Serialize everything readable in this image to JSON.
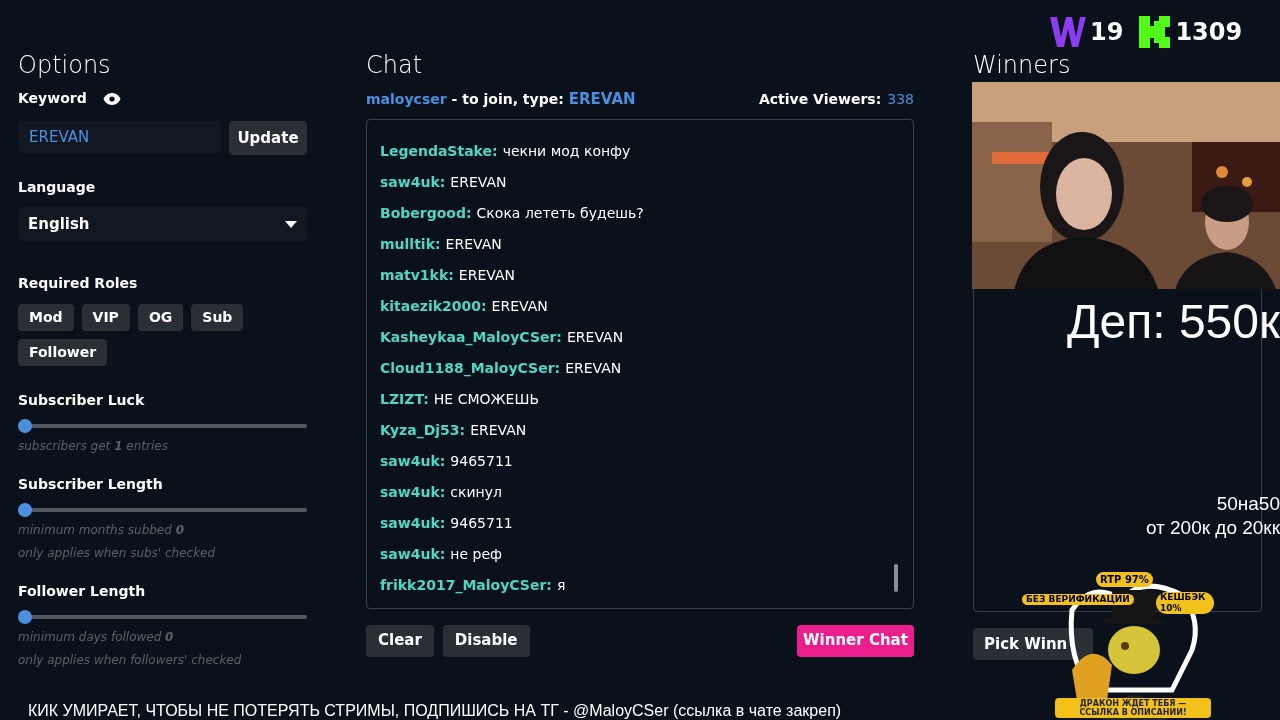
{
  "options": {
    "title": "Options",
    "keyword_label": "Keyword",
    "keyword": {
      "value": "EREVAN"
    },
    "update_button": "Update",
    "language_label": "Language",
    "language": "English",
    "roles_label": "Required Roles",
    "roles": [
      {
        "label": "Mod",
        "selected": false
      },
      {
        "label": "VIP",
        "selected": false
      },
      {
        "label": "OG",
        "selected": false
      },
      {
        "label": "Sub",
        "selected": false
      },
      {
        "label": "Follower",
        "selected": false
      }
    ],
    "sliders": [
      {
        "label": "Subscriber Luck",
        "level": 0,
        "notes": [
          "subscribers get **1** entries"
        ]
      },
      {
        "label": "Subscriber Length",
        "level": 0,
        "notes": [
          "minimum months subbed **0**",
          "only applies when subs' checked"
        ]
      },
      {
        "label": "Follower Length",
        "level": 0,
        "notes": [
          "minimum days followed **0**",
          "only applies when followers' checked"
        ]
      }
    ]
  },
  "chat": {
    "title": "Chat",
    "channel": "maloycser",
    "join_text": "- to join, type:",
    "keyword": "EREVAN",
    "viewers_label": "Active Viewers:",
    "viewers": "338",
    "messages": [
      {
        "user": "LegendaStake:",
        "text": "чекни мод конфу"
      },
      {
        "user": "saw4uk:",
        "text": "EREVAN"
      },
      {
        "user": "Bobergood:",
        "text": "Скока лететь будешь?"
      },
      {
        "user": "mulltik:",
        "text": "EREVAN"
      },
      {
        "user": "matv1kk:",
        "text": "EREVAN"
      },
      {
        "user": "kitaezik2000:",
        "text": "EREVAN"
      },
      {
        "user": "Kasheykaa_MaloyCSer:",
        "text": "EREVAN"
      },
      {
        "user": "Cloud1188_MaloyCSer:",
        "text": "EREVAN"
      },
      {
        "user": "LZIZT:",
        "text": "НЕ СМОЖЕШЬ"
      },
      {
        "user": "Kyza_Dj53:",
        "text": "EREVAN"
      },
      {
        "user": "saw4uk:",
        "text": "9465711"
      },
      {
        "user": "saw4uk:",
        "text": "скинул"
      },
      {
        "user": "saw4uk:",
        "text": "9465711"
      },
      {
        "user": "saw4uk:",
        "text": "не реф"
      },
      {
        "user": "frikk2017_MaloyCSer:",
        "text": "я"
      }
    ],
    "buttons": [
      {
        "label": "Clear",
        "kind": "plain"
      },
      {
        "label": "Disable",
        "kind": "plain"
      },
      {
        "label": "Winner Chat",
        "kind": "accent"
      }
    ]
  },
  "winners": {
    "title": "Winners",
    "pick_button": "Pick Winn"
  },
  "overlay": {
    "counters": [
      {
        "kind": "w",
        "value": "19"
      },
      {
        "kind": "k",
        "value": "1309"
      }
    ],
    "deposit": "Деп: 550к",
    "notes": [
      "50на50",
      "от 200к до 20кк"
    ],
    "ad": {
      "badges": [
        "RTP 97%",
        "БЕЗ ВЕРИФИКАЦИИ",
        "КЕШБЭК 10%"
      ],
      "banner": [
        "ДРАКОН ЖДЕТ ТЕБЯ —",
        "ССЫЛКА В ОПИСАНИИ!"
      ]
    },
    "subtitle": "КИК УМИРАЕТ, ЧТОБЫ НЕ ПОТЕРЯТЬ СТРИМЫ, ПОДПИШИСЬ НА ТГ - @MaloyCSer (ссылка в чате закреп)"
  }
}
